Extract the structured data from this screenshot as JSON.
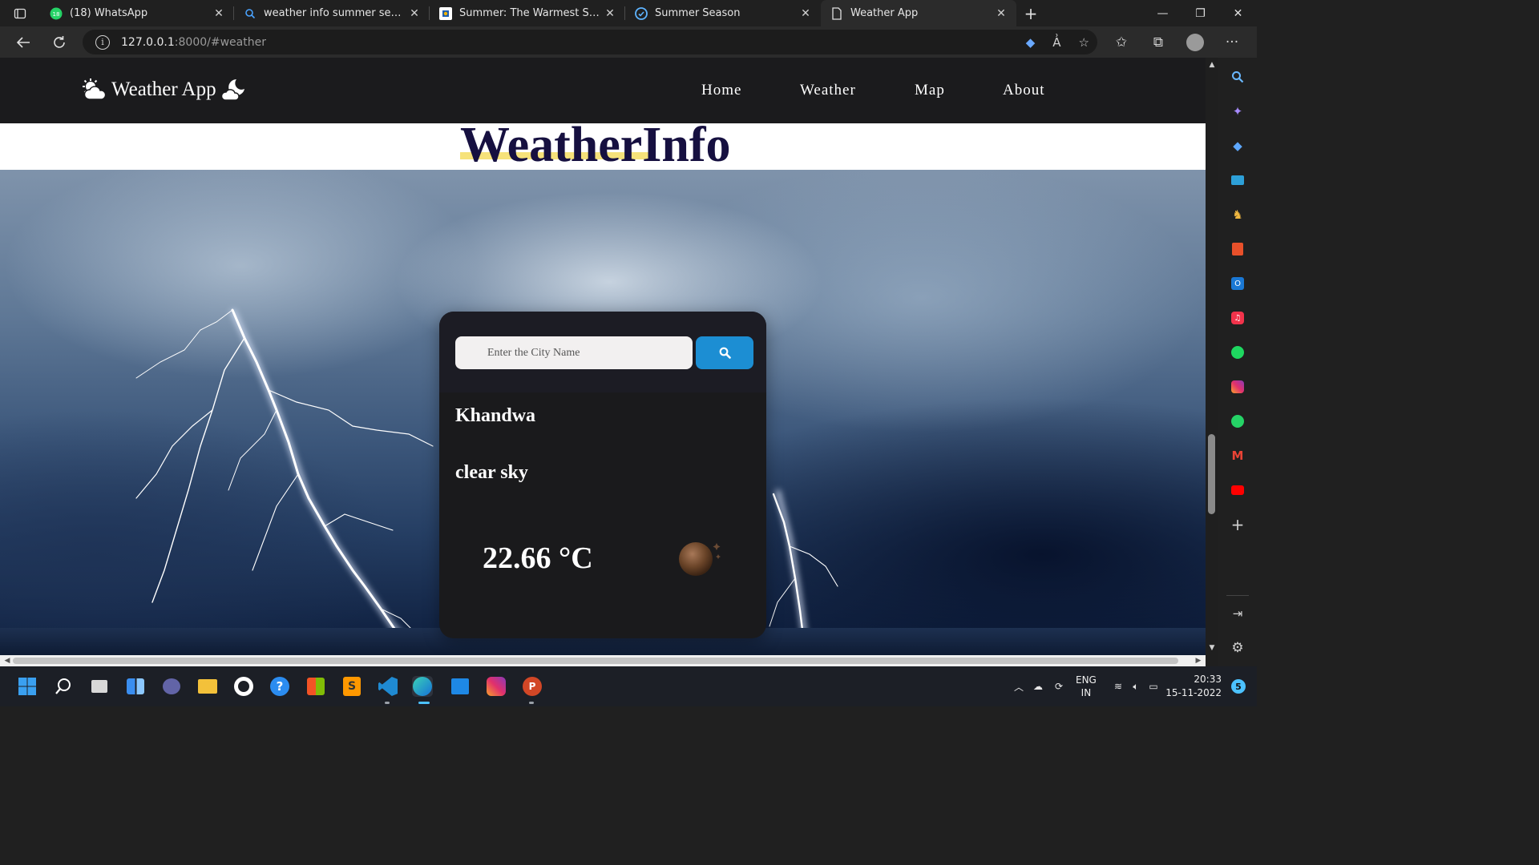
{
  "browser": {
    "tabs": [
      {
        "title": "(18) WhatsApp",
        "icon": "whatsapp-icon"
      },
      {
        "title": "weather info summer seasion - S",
        "icon": "search-icon"
      },
      {
        "title": "Summer: The Warmest Season | ",
        "icon": "britannica-icon"
      },
      {
        "title": "Summer Season",
        "icon": "edge-icon"
      },
      {
        "title": "Weather App",
        "icon": "page-icon"
      }
    ],
    "url_host": "127.0.0.1",
    "url_rest": ":8000/#weather"
  },
  "site": {
    "brand": "Weather App",
    "nav": [
      "Home",
      "Weather",
      "Map",
      "About"
    ],
    "heading": "WeatherInfo"
  },
  "weather": {
    "search_placeholder": "Enter the City Name",
    "search_value": "",
    "city": "Khandwa",
    "description": "clear sky",
    "temperature": "22.66 °C",
    "icon": "clear-night-moon-icon"
  },
  "taskbar": {
    "lang_top": "ENG",
    "lang_bottom": "IN",
    "time": "20:33",
    "date": "15-11-2022",
    "notifications": "5"
  },
  "colors": {
    "accent": "#1c8ed3",
    "heading": "#161040",
    "highlight": "#f6e27a",
    "nav_bg": "#1b1b1d",
    "card_bg": "#1a1a1c"
  }
}
